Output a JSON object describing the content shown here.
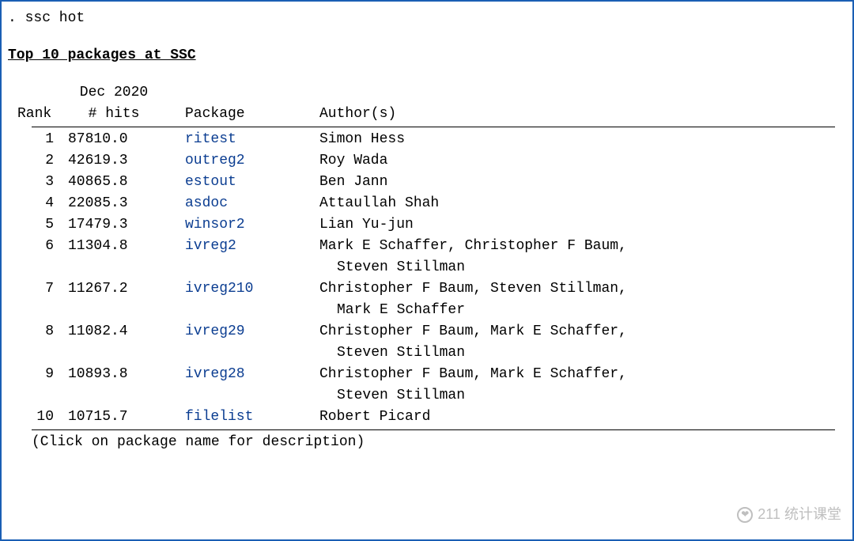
{
  "prompt": ". ssc hot",
  "title": "Top 10 packages at SSC",
  "headers": {
    "month": "Dec 2020",
    "rank": "Rank",
    "hits": "# hits",
    "package": "Package",
    "authors": "Author(s)"
  },
  "rows": [
    {
      "rank": "1",
      "hits": "87810.0",
      "package": "ritest",
      "authors": "Simon Hess"
    },
    {
      "rank": "2",
      "hits": "42619.3",
      "package": "outreg2",
      "authors": "Roy Wada"
    },
    {
      "rank": "3",
      "hits": "40865.8",
      "package": "estout",
      "authors": "Ben Jann"
    },
    {
      "rank": "4",
      "hits": "22085.3",
      "package": "asdoc",
      "authors": "Attaullah Shah"
    },
    {
      "rank": "5",
      "hits": "17479.3",
      "package": "winsor2",
      "authors": "Lian Yu-jun"
    },
    {
      "rank": "6",
      "hits": "11304.8",
      "package": "ivreg2",
      "authors": "Mark E Schaffer, Christopher F Baum,",
      "authors2": "Steven Stillman"
    },
    {
      "rank": "7",
      "hits": "11267.2",
      "package": "ivreg210",
      "authors": "Christopher F Baum, Steven Stillman,",
      "authors2": "Mark E Schaffer"
    },
    {
      "rank": "8",
      "hits": "11082.4",
      "package": "ivreg29",
      "authors": "Christopher F Baum, Mark E Schaffer,",
      "authors2": "Steven Stillman"
    },
    {
      "rank": "9",
      "hits": "10893.8",
      "package": "ivreg28",
      "authors": "Christopher F Baum, Mark E Schaffer,",
      "authors2": "Steven Stillman"
    },
    {
      "rank": "10",
      "hits": "10715.7",
      "package": "filelist",
      "authors": "Robert Picard"
    }
  ],
  "footer": "(Click on package name for description)",
  "watermark": "211 统计课堂"
}
